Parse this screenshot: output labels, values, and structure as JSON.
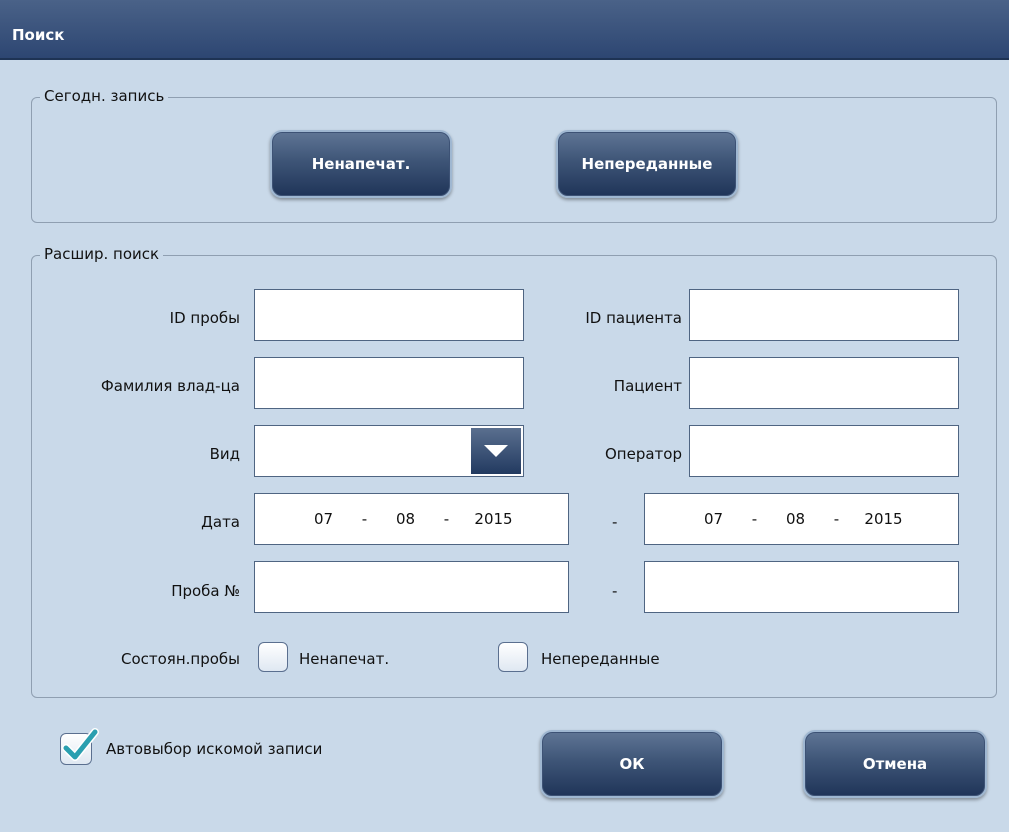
{
  "window": {
    "title": "Поиск"
  },
  "today_group": {
    "legend": "Сегодн. запись",
    "btn_unprinted": "Ненапечат.",
    "btn_untransmitted": "Непереданные"
  },
  "adv_group": {
    "legend": "Расшир. поиск",
    "sample_id_label": "ID пробы",
    "sample_id_value": "",
    "patient_id_label": "ID пациента",
    "patient_id_value": "",
    "owner_label": "Фамилия влад-ца",
    "owner_value": "",
    "patient_label": "Пациент",
    "patient_value": "",
    "kind_label": "Вид",
    "kind_value": "",
    "operator_label": "Оператор",
    "operator_value": "",
    "date_label": "Дата",
    "date_from": {
      "day": "07",
      "month": "08",
      "year": "2015"
    },
    "date_to": {
      "day": "07",
      "month": "08",
      "year": "2015"
    },
    "date_sep": "-",
    "range_sep": "-",
    "sample_no_label": "Проба №",
    "sample_no_from": "",
    "sample_no_to": "",
    "sample_status_label": "Состоян.пробы",
    "status_unprinted_label": "Ненапечат.",
    "status_untransmitted_label": "Непереданные"
  },
  "footer": {
    "autoselect_label": "Автовыбор искомой записи",
    "autoselect_checked": true,
    "ok_label": "ОК",
    "cancel_label": "Отмена"
  },
  "colors": {
    "background": "#c9d9e9",
    "titlebar": "#2d4672",
    "button": "#2f4669",
    "checkmark": "#2a9fb0"
  }
}
